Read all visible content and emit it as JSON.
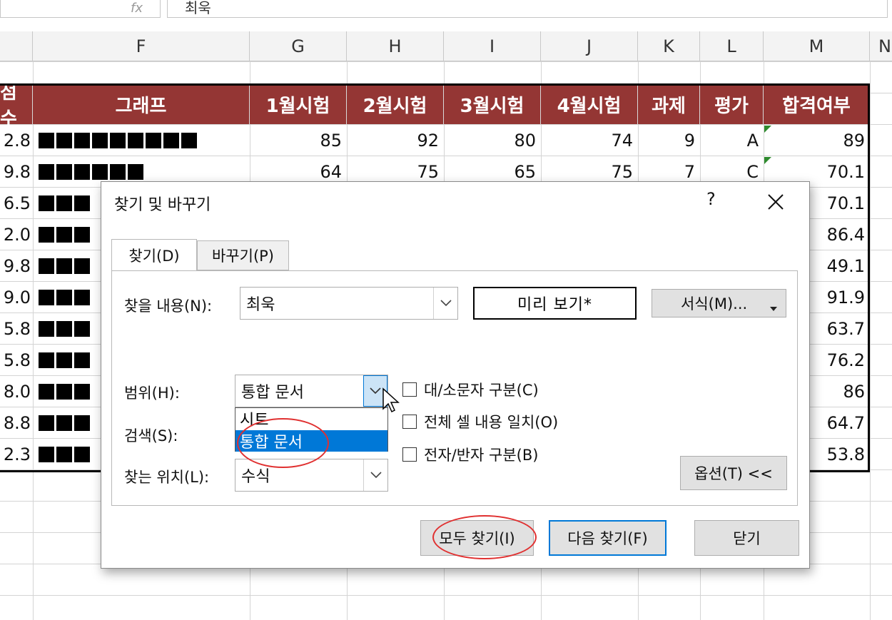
{
  "formula_bar": {
    "value": "최욱"
  },
  "columns": [
    "F",
    "G",
    "H",
    "I",
    "J",
    "K",
    "L",
    "M"
  ],
  "table": {
    "headers": [
      "점수",
      "그래프",
      "1월시험",
      "2월시험",
      "3월시험",
      "4월시험",
      "과제",
      "평가",
      "합격여부"
    ],
    "rows": [
      [
        "2.8",
        "",
        "85",
        "92",
        "80",
        "74",
        "9",
        "A",
        "89"
      ],
      [
        "9.8",
        "",
        "64",
        "75",
        "65",
        "75",
        "7",
        "C",
        "70.1"
      ],
      [
        "6.5",
        "",
        "",
        "",
        "",
        "",
        "",
        "",
        "70.1"
      ],
      [
        "2.0",
        "",
        "",
        "",
        "",
        "",
        "",
        "",
        "86.4"
      ],
      [
        "9.8",
        "",
        "",
        "",
        "",
        "",
        "",
        "",
        "49.1"
      ],
      [
        "9.0",
        "",
        "",
        "",
        "",
        "",
        "",
        "",
        "91.9"
      ],
      [
        "5.8",
        "",
        "",
        "",
        "",
        "",
        "",
        "",
        "63.7"
      ],
      [
        "5.8",
        "",
        "",
        "",
        "",
        "",
        "",
        "",
        "76.2"
      ],
      [
        "8.0",
        "",
        "",
        "",
        "",
        "",
        "",
        "",
        "86"
      ],
      [
        "8.8",
        "",
        "",
        "",
        "",
        "",
        "",
        "",
        "64.7"
      ],
      [
        "2.3",
        "",
        "",
        "",
        "",
        "",
        "",
        "",
        "53.8"
      ]
    ],
    "graph_blocks": [
      9,
      6,
      3,
      3,
      3,
      3,
      3,
      3,
      3,
      3,
      3
    ],
    "header_color": "#943634"
  },
  "dialog": {
    "title": "찾기 및 바꾸기",
    "help": "?",
    "tabs": [
      {
        "label": "찾기(D)",
        "active": true
      },
      {
        "label": "바꾸기(P)",
        "active": false
      }
    ],
    "find_label": "찾을 내용(N):",
    "find_value": "최욱",
    "preview": "미리 보기*",
    "format_button": "서식(M)...",
    "scope_label": "범위(H):",
    "scope_value": "통합 문서",
    "scope_options": [
      "시트",
      "통합 문서"
    ],
    "search_label": "검색(S):",
    "lookin_label": "찾는 위치(L):",
    "lookin_value": "수식",
    "match_case": "대/소문자 구분(C)",
    "match_entire": "전체 셀 내용 일치(O)",
    "match_byte": "전자/반자 구분(B)",
    "options_button": "옵션(T) <<",
    "find_all": "모두 찾기(I)",
    "find_next": "다음 찾기(F)",
    "close": "닫기",
    "accent_color": "#0078d7",
    "annotation_color": "#e03030"
  }
}
